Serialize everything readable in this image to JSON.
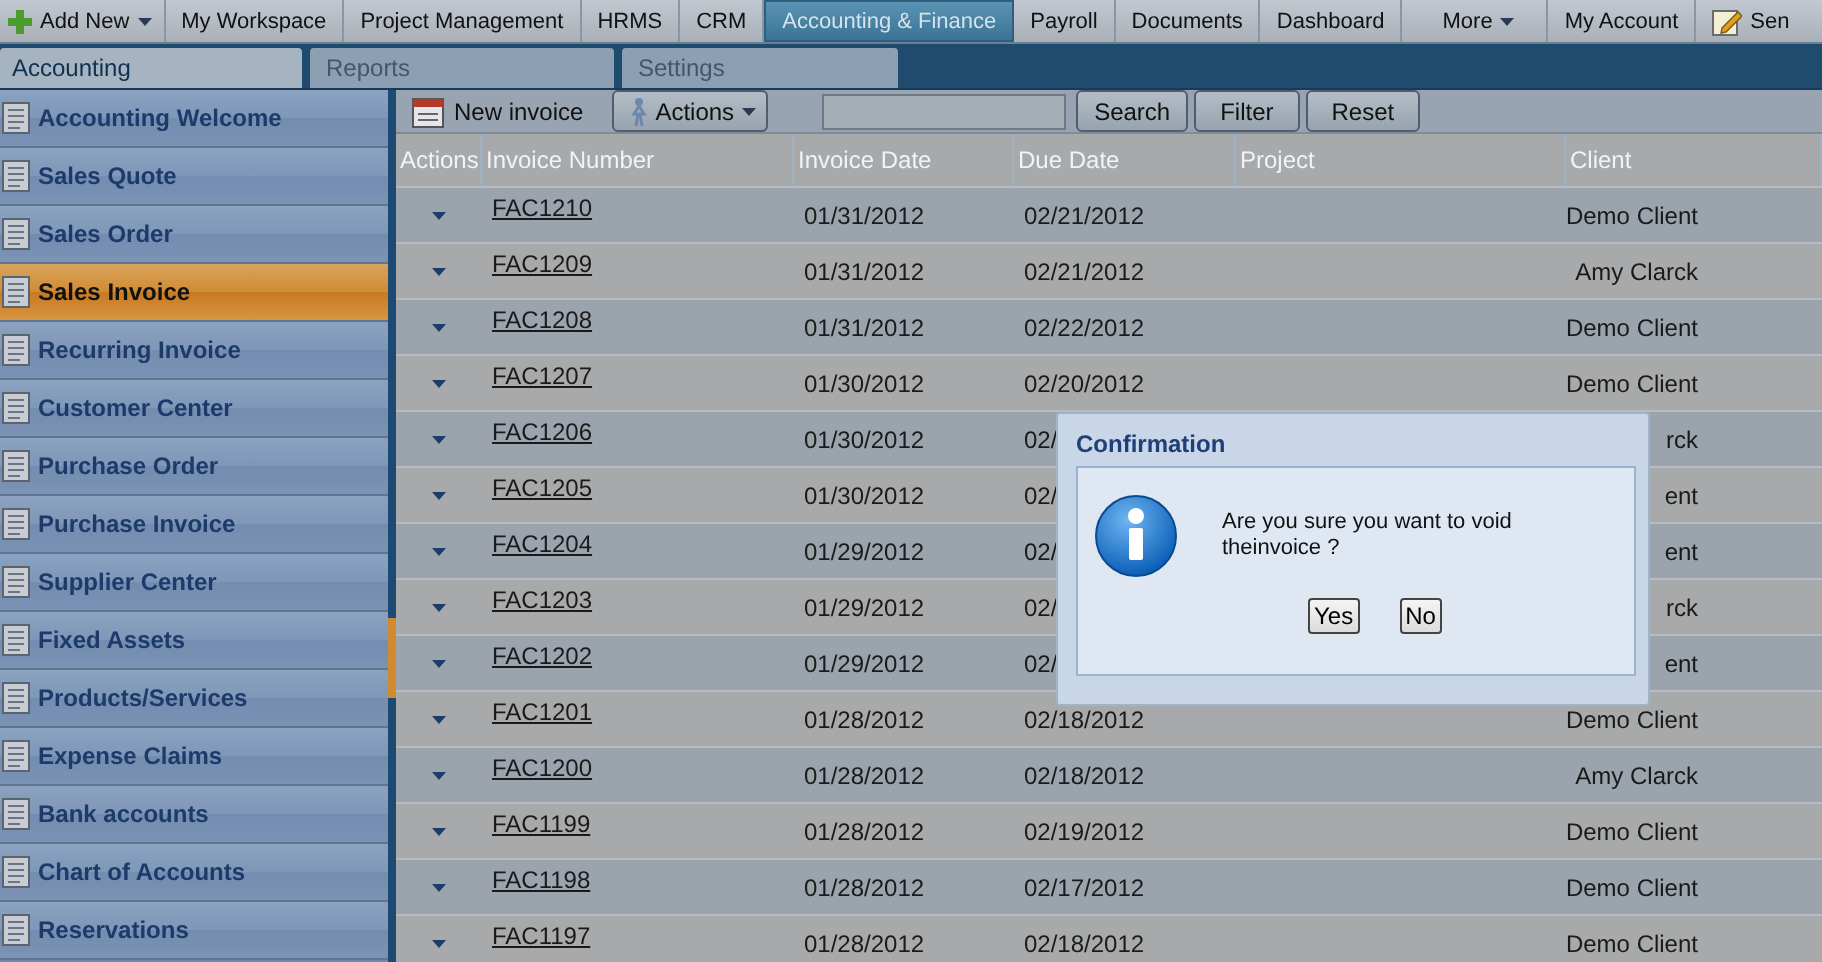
{
  "top_nav": {
    "add_new": "Add New",
    "items": [
      {
        "label": "My Workspace",
        "kind": "link",
        "selected": false
      },
      {
        "label": "Project Management",
        "kind": "link",
        "selected": false
      },
      {
        "label": "HRMS",
        "kind": "link",
        "selected": false
      },
      {
        "label": "CRM",
        "kind": "link",
        "selected": false
      },
      {
        "label": "Accounting & Finance",
        "kind": "link",
        "selected": true
      },
      {
        "label": "Payroll",
        "kind": "link",
        "selected": false
      },
      {
        "label": "Documents",
        "kind": "link",
        "selected": false
      },
      {
        "label": "Dashboard",
        "kind": "link",
        "selected": false
      },
      {
        "label": "More",
        "kind": "menu",
        "selected": false
      },
      {
        "label": "My Account",
        "kind": "link",
        "selected": false
      },
      {
        "label": "Sen",
        "kind": "icon-link",
        "selected": false
      }
    ]
  },
  "sub_tabs": [
    {
      "label": "Accounting",
      "selected": true
    },
    {
      "label": "Reports",
      "selected": false
    },
    {
      "label": "Settings",
      "selected": false
    }
  ],
  "sidebar": {
    "items": [
      {
        "label": "Accounting Welcome",
        "selected": false
      },
      {
        "label": "Sales Quote",
        "selected": false
      },
      {
        "label": "Sales Order",
        "selected": false
      },
      {
        "label": "Sales Invoice",
        "selected": true
      },
      {
        "label": "Recurring Invoice",
        "selected": false
      },
      {
        "label": "Customer Center",
        "selected": false
      },
      {
        "label": "Purchase Order",
        "selected": false
      },
      {
        "label": "Purchase Invoice",
        "selected": false
      },
      {
        "label": "Supplier Center",
        "selected": false
      },
      {
        "label": "Fixed Assets",
        "selected": false
      },
      {
        "label": "Products/Services",
        "selected": false
      },
      {
        "label": "Expense Claims",
        "selected": false
      },
      {
        "label": "Bank accounts",
        "selected": false
      },
      {
        "label": "Chart of Accounts",
        "selected": false
      },
      {
        "label": "Reservations",
        "selected": false
      }
    ]
  },
  "toolbar": {
    "new_invoice": "New invoice",
    "actions": "Actions",
    "search_button": "Search",
    "filter_button": "Filter",
    "reset_button": "Reset"
  },
  "table": {
    "columns": [
      "Actions",
      "Invoice Number",
      "Invoice Date",
      "Due Date",
      "Project",
      "Client"
    ],
    "rows": [
      {
        "invoice_number": "FAC1210",
        "invoice_date": "01/31/2012",
        "due_date": "02/21/2012",
        "client": "Demo Client"
      },
      {
        "invoice_number": "FAC1209",
        "invoice_date": "01/31/2012",
        "due_date": "02/21/2012",
        "client": "Amy Clarck"
      },
      {
        "invoice_number": "FAC1208",
        "invoice_date": "01/31/2012",
        "due_date": "02/22/2012",
        "client": "Demo Client"
      },
      {
        "invoice_number": "FAC1207",
        "invoice_date": "01/30/2012",
        "due_date": "02/20/2012",
        "client": "Demo Client"
      },
      {
        "invoice_number": "FAC1206",
        "invoice_date": "01/30/2012",
        "due_date": "02/",
        "client": "rck"
      },
      {
        "invoice_number": "FAC1205",
        "invoice_date": "01/30/2012",
        "due_date": "02/",
        "client": "ent"
      },
      {
        "invoice_number": "FAC1204",
        "invoice_date": "01/29/2012",
        "due_date": "02/",
        "client": "ent"
      },
      {
        "invoice_number": "FAC1203",
        "invoice_date": "01/29/2012",
        "due_date": "02/",
        "client": "rck"
      },
      {
        "invoice_number": "FAC1202",
        "invoice_date": "01/29/2012",
        "due_date": "02/",
        "client": "ent"
      },
      {
        "invoice_number": "FAC1201",
        "invoice_date": "01/28/2012",
        "due_date": "02/18/2012",
        "client": "Demo Client"
      },
      {
        "invoice_number": "FAC1200",
        "invoice_date": "01/28/2012",
        "due_date": "02/18/2012",
        "client": "Amy Clarck"
      },
      {
        "invoice_number": "FAC1199",
        "invoice_date": "01/28/2012",
        "due_date": "02/19/2012",
        "client": "Demo Client"
      },
      {
        "invoice_number": "FAC1198",
        "invoice_date": "01/28/2012",
        "due_date": "02/17/2012",
        "client": "Demo Client"
      },
      {
        "invoice_number": "FAC1197",
        "invoice_date": "01/28/2012",
        "due_date": "02/18/2012",
        "client": "Demo Client"
      }
    ]
  },
  "dialog": {
    "title": "Confirmation",
    "message": "Are you sure you want to void theinvoice ?",
    "buttons": [
      "Yes",
      "No"
    ]
  }
}
